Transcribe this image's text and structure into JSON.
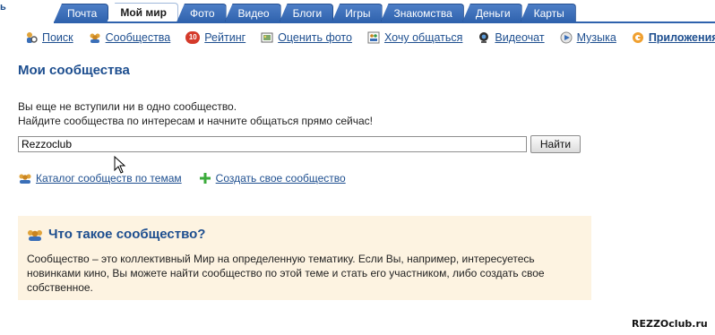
{
  "top_edge_char": "ь",
  "tabs": [
    {
      "label": "Почта",
      "active": false
    },
    {
      "label": "Мой мир",
      "active": true
    },
    {
      "label": "Фото",
      "active": false
    },
    {
      "label": "Видео",
      "active": false
    },
    {
      "label": "Блоги",
      "active": false
    },
    {
      "label": "Игры",
      "active": false
    },
    {
      "label": "Знакомства",
      "active": false
    },
    {
      "label": "Деньги",
      "active": false
    },
    {
      "label": "Карты",
      "active": false
    }
  ],
  "subnav": [
    {
      "label": "Поиск",
      "icon": "search-people-icon",
      "bold": false
    },
    {
      "label": "Сообщества",
      "icon": "communities-icon",
      "bold": false
    },
    {
      "label": "Рейтинг",
      "icon": "rating-icon",
      "badge": "10",
      "bold": false
    },
    {
      "label": "Оценить фото",
      "icon": "photo-rate-icon",
      "bold": false
    },
    {
      "label": "Хочу общаться",
      "icon": "chat-icon",
      "bold": false
    },
    {
      "label": "Видеочат",
      "icon": "webcam-icon",
      "bold": false
    },
    {
      "label": "Музыка",
      "icon": "music-icon",
      "bold": false
    },
    {
      "label": "Приложения",
      "icon": "apps-icon",
      "bold": true
    }
  ],
  "page": {
    "title": "Мои сообщества",
    "info_line1": "Вы еще не вступили ни в одно сообщество.",
    "info_line2": "Найдите сообщества по интересам и начните общаться прямо сейчас!"
  },
  "search": {
    "value": "Rezzoclub",
    "button_label": "Найти"
  },
  "links": {
    "catalog": "Каталог сообществ по темам",
    "create": "Создать свое сообщество"
  },
  "infobox": {
    "title": "Что такое сообщество?",
    "line1": "Сообщество – это коллективный Мир на определенную тематику. Если Вы, например, интересуетесь",
    "line2": "новинками кино, Вы можете найти сообщество по этой теме и стать его участником, либо создать свое",
    "line3": "собственное."
  },
  "watermark": "REZZOclub.ru",
  "colors": {
    "tab_blue": "#2f62ad",
    "link_blue": "#1d4e8f",
    "infobox_bg": "#fdf3e1"
  }
}
